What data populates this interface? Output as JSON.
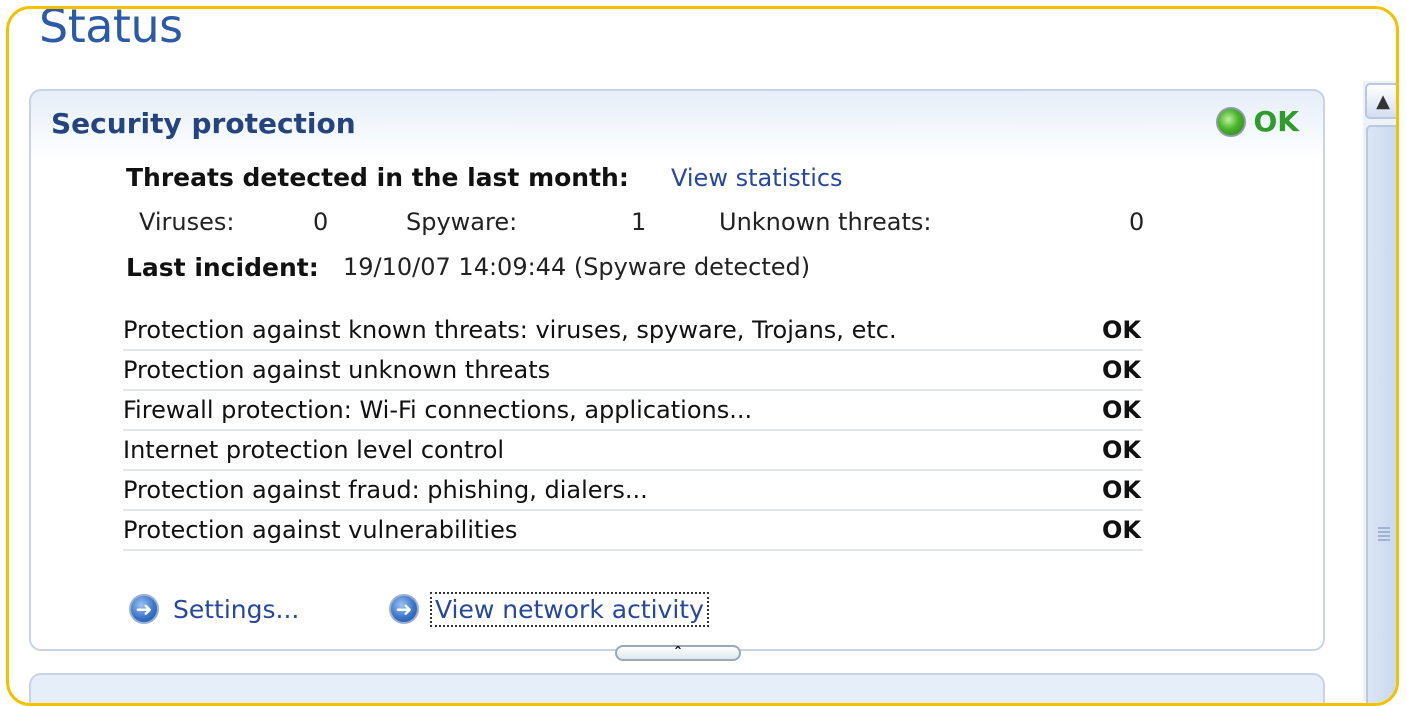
{
  "page": {
    "title": "Status"
  },
  "security": {
    "title": "Security protection",
    "status": "OK",
    "threats_heading": "Threats detected in the last month:",
    "view_statistics": "View statistics",
    "counts": [
      {
        "label": "Viruses:",
        "value": "0"
      },
      {
        "label": "Spyware:",
        "value": "1"
      },
      {
        "label": "Unknown threats:",
        "value": "0"
      }
    ],
    "last_incident_label": "Last incident:",
    "last_incident_value": "19/10/07 14:09:44 (Spyware detected)",
    "protections": [
      {
        "label": "Protection against known threats: viruses, spyware, Trojans, etc.",
        "status": "OK"
      },
      {
        "label": "Protection against unknown threats",
        "status": "OK"
      },
      {
        "label": "Firewall protection:  Wi-Fi connections, applications...",
        "status": "OK"
      },
      {
        "label": "Internet protection level control",
        "status": "OK"
      },
      {
        "label": "Protection against fraud: phishing, dialers...",
        "status": "OK"
      },
      {
        "label": "Protection against vulnerabilities",
        "status": "OK"
      }
    ],
    "settings_link": "Settings...",
    "network_link": "View network activity"
  },
  "icons": {
    "status": "green-circle-icon",
    "link": "arrow-right-circle-icon",
    "collapse": "chevron-up-icon",
    "scroll_up": "scroll-up-arrow-icon"
  },
  "colors": {
    "frame_border": "#f2c200",
    "title": "#2c5aa8",
    "panel_title": "#24437f",
    "ok_green": "#2e9b2a",
    "link": "#2747a0"
  }
}
